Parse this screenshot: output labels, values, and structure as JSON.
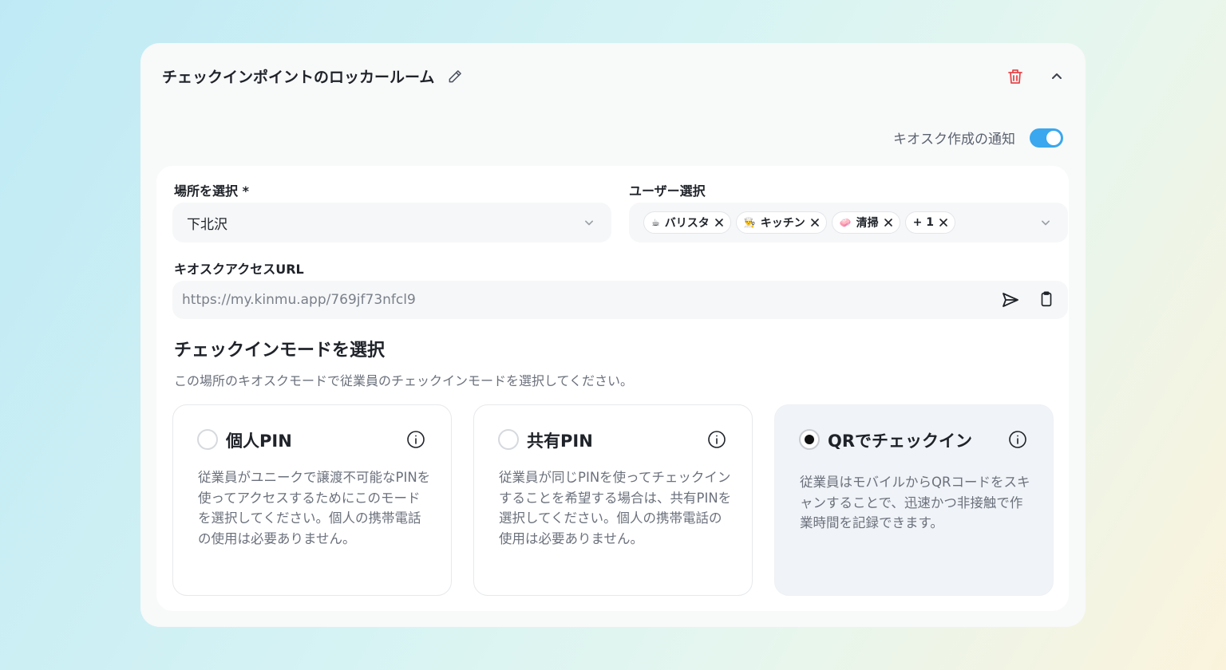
{
  "panel": {
    "title": "チェックインポイントのロッカールーム",
    "notify_label": "キオスク作成の通知",
    "notify_on": true
  },
  "location": {
    "label": "場所を選択 *",
    "value": "下北沢"
  },
  "users": {
    "label": "ユーザー選択",
    "chips": [
      {
        "emoji": "☕",
        "text": "バリスタ"
      },
      {
        "emoji": "👨‍🍳",
        "text": "キッチン"
      },
      {
        "emoji": "🧼",
        "text": "清掃"
      },
      {
        "emoji": "",
        "text": "+ 1"
      }
    ]
  },
  "kiosk_url": {
    "label": "キオスクアクセスURL",
    "value": "https://my.kinmu.app/769jf73nfcl9"
  },
  "checkin_mode": {
    "title": "チェックインモードを選択",
    "description": "この場所のキオスクモードで従業員のチェックインモードを選択してください。",
    "options": [
      {
        "title": "個人PIN",
        "description": "従業員がユニークで譲渡不可能なPINを使ってアクセスするためにこのモードを選択してください。個人の携帯電話の使用は必要ありません。",
        "selected": false
      },
      {
        "title": "共有PIN",
        "description": "従業員が同じPINを使ってチェックインすることを希望する場合は、共有PINを選択してください。個人の携帯電話の使用は必要ありません。",
        "selected": false
      },
      {
        "title": "QRでチェックイン",
        "description": "従業員はモバイルからQRコードをスキャンすることで、迅速かつ非接触で作業時間を記録できます。",
        "selected": true
      }
    ]
  },
  "colors": {
    "accent": "#3aa7ee",
    "danger": "#e5484d"
  }
}
